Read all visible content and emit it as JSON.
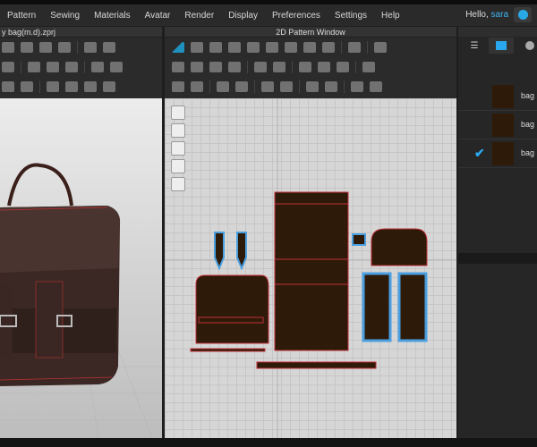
{
  "menubar": {
    "items": [
      "Pattern",
      "Sewing",
      "Materials",
      "Avatar",
      "Render",
      "Display",
      "Preferences",
      "Settings",
      "Help"
    ],
    "greeting": "Hello,",
    "user": "sara"
  },
  "panels": {
    "view3d_title": "y bag(m.d).zprj",
    "pattern_title": "2D Pattern Window"
  },
  "right_panel": {
    "items": [
      {
        "name": "bag",
        "checked": false
      },
      {
        "name": "bag",
        "checked": false
      },
      {
        "name": "bag",
        "checked": true
      }
    ],
    "check": "✔"
  },
  "colors": {
    "fabric": "#2e1a08",
    "accent": "#29a8e8",
    "seam": "#c0303a"
  }
}
